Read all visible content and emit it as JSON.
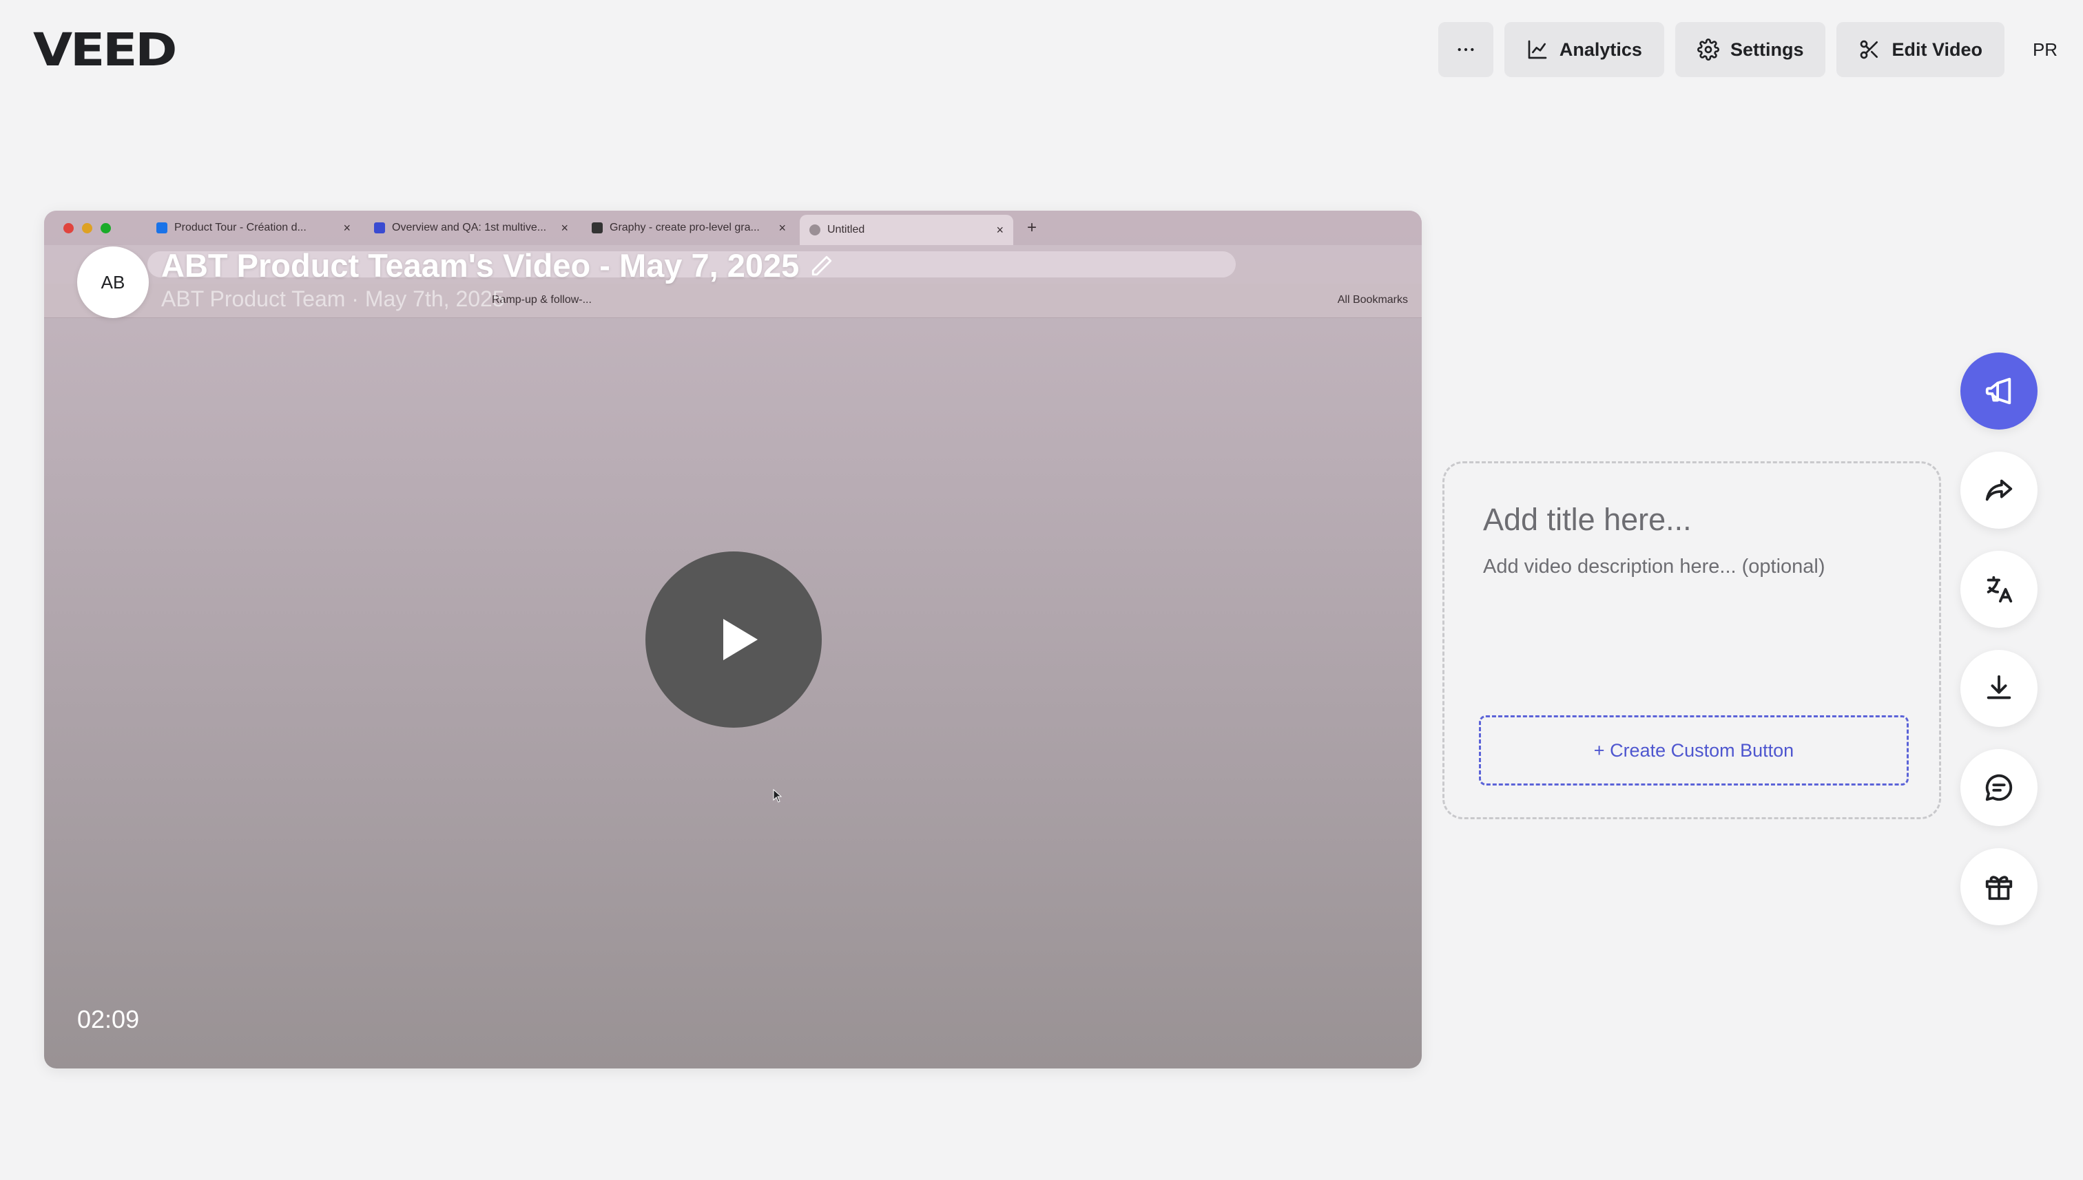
{
  "app": {
    "logo": "VEED"
  },
  "toolbar": {
    "more_label": "···",
    "analytics_label": "Analytics",
    "settings_label": "Settings",
    "edit_video_label": "Edit Video",
    "user_initials": "PR"
  },
  "video": {
    "title": "ABT Product Teaam's Video - May 7, 2025",
    "subtitle": "ABT Product Team · May 7th, 2025",
    "owner_initials": "AB",
    "duration": "02:09"
  },
  "recording": {
    "tabs": [
      {
        "title": "Product Tour - Création d...",
        "favicon_color": "#1a73e8"
      },
      {
        "title": "Overview and QA: 1st multive...",
        "favicon_color": "#3a4bd1"
      },
      {
        "title": "Graphy - create pro-level gra...",
        "favicon_color": "#333333"
      },
      {
        "title": "Untitled",
        "favicon_color": "#9a8f95"
      }
    ],
    "bookmark_item": "Ramp-up & follow-...",
    "all_bookmarks": "All Bookmarks"
  },
  "info_card": {
    "title_placeholder": "Add title here...",
    "description_placeholder": "Add video description here... (optional)",
    "custom_button_label": "+ Create Custom Button"
  },
  "side_actions": [
    {
      "icon": "megaphone-icon",
      "active": true
    },
    {
      "icon": "share-icon"
    },
    {
      "icon": "translate-icon"
    },
    {
      "icon": "download-icon"
    },
    {
      "icon": "comment-icon"
    },
    {
      "icon": "gift-icon"
    }
  ],
  "colors": {
    "accent": "#5b63e6",
    "background": "#f3f3f4",
    "button_bg": "#e6e6e8"
  }
}
